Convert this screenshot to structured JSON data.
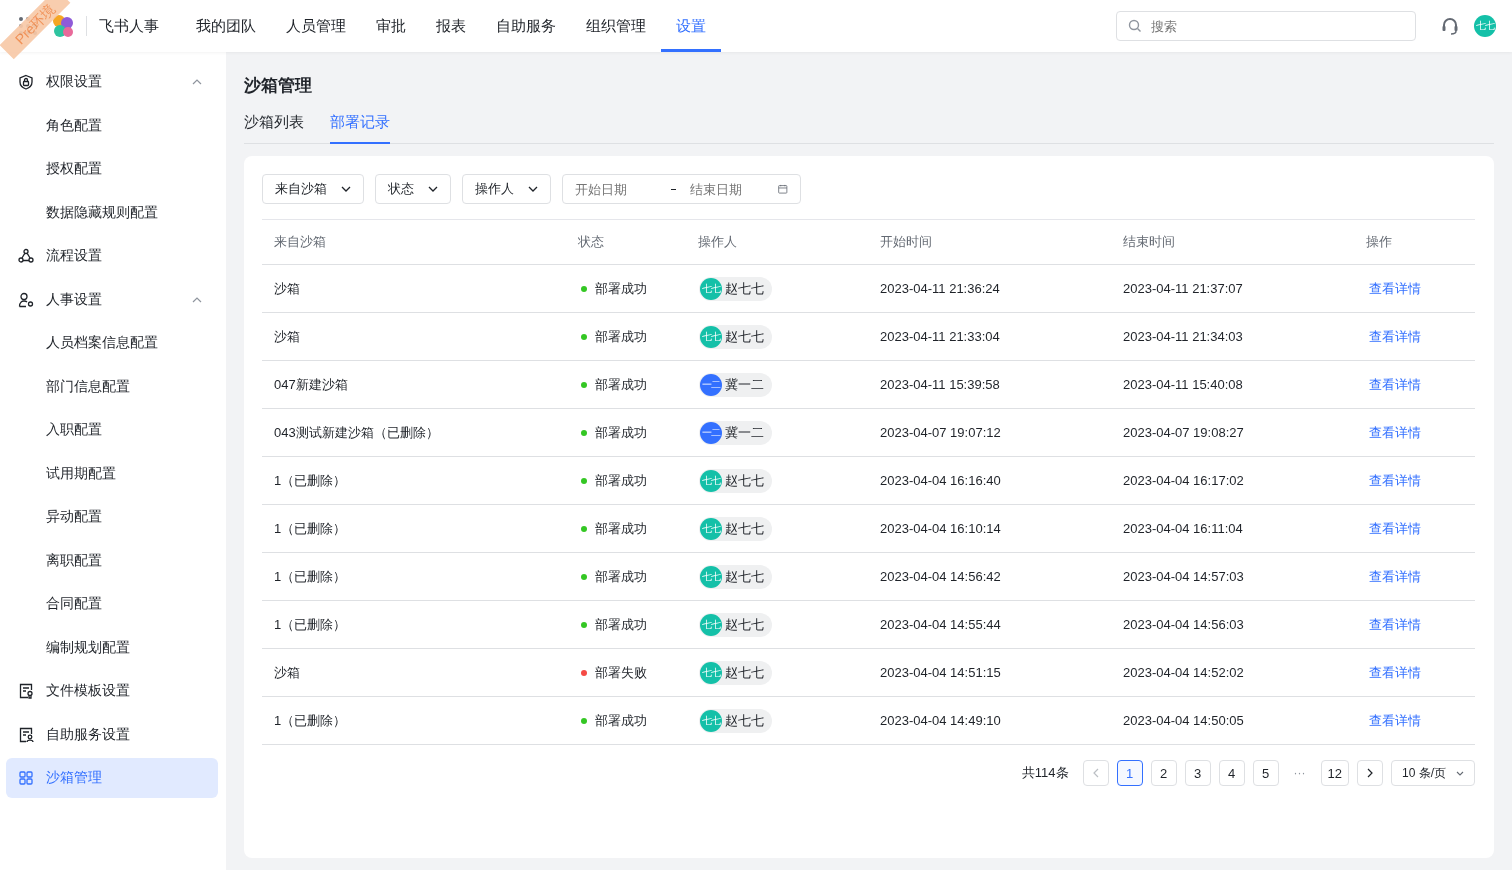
{
  "env_ribbon": "Pre环境",
  "header": {
    "app_name": "飞书人事",
    "nav": [
      {
        "label": "我的团队",
        "selected": false
      },
      {
        "label": "人员管理",
        "selected": false
      },
      {
        "label": "审批",
        "selected": false
      },
      {
        "label": "报表",
        "selected": false
      },
      {
        "label": "自助服务",
        "selected": false
      },
      {
        "label": "组织管理",
        "selected": false
      },
      {
        "label": "设置",
        "selected": true
      }
    ],
    "search": {
      "placeholder": "搜索"
    },
    "avatar": "七七"
  },
  "sidebar": {
    "items": [
      {
        "label": "权限设置",
        "expanded": true,
        "selected": false,
        "children": [
          {
            "label": "角色配置",
            "selected": false
          },
          {
            "label": "授权配置",
            "selected": false
          },
          {
            "label": "数据隐藏规则配置",
            "selected": false
          }
        ]
      },
      {
        "label": "流程设置",
        "selected": false
      },
      {
        "label": "人事设置",
        "expanded": true,
        "selected": false,
        "children": [
          {
            "label": "人员档案信息配置",
            "selected": false
          },
          {
            "label": "部门信息配置",
            "selected": false
          },
          {
            "label": "入职配置",
            "selected": false
          },
          {
            "label": "试用期配置",
            "selected": false
          },
          {
            "label": "异动配置",
            "selected": false
          },
          {
            "label": "离职配置",
            "selected": false
          },
          {
            "label": "合同配置",
            "selected": false
          },
          {
            "label": "编制规划配置",
            "selected": false
          }
        ]
      },
      {
        "label": "文件模板设置",
        "selected": false
      },
      {
        "label": "自助服务设置",
        "selected": false
      },
      {
        "label": "沙箱管理",
        "selected": true
      }
    ]
  },
  "page": {
    "title": "沙箱管理",
    "tabs": [
      {
        "label": "沙箱列表",
        "selected": false
      },
      {
        "label": "部署记录",
        "selected": true
      }
    ],
    "filters": {
      "selects": [
        "来自沙箱",
        "状态",
        "操作人"
      ],
      "date_range": {
        "start_placeholder": "开始日期",
        "end_placeholder": "结束日期"
      }
    },
    "table": {
      "columns": [
        "来自沙箱",
        "状态",
        "操作人",
        "开始时间",
        "结束时间",
        "操作"
      ],
      "rows": [
        {
          "source": "沙箱",
          "status": {
            "text": "部署成功",
            "color": "#34c724"
          },
          "operator": {
            "avatar": "七七",
            "name": "赵七七",
            "color": "#14c0a8"
          },
          "start": "2023-04-11 21:36:24",
          "end": "2023-04-11 21:37:07",
          "action": "查看详情"
        },
        {
          "source": "沙箱",
          "status": {
            "text": "部署成功",
            "color": "#34c724"
          },
          "operator": {
            "avatar": "七七",
            "name": "赵七七",
            "color": "#14c0a8"
          },
          "start": "2023-04-11 21:33:04",
          "end": "2023-04-11 21:34:03",
          "action": "查看详情"
        },
        {
          "source": "047新建沙箱",
          "status": {
            "text": "部署成功",
            "color": "#34c724"
          },
          "operator": {
            "avatar": "一二",
            "name": "冀一二",
            "color": "#3370ff"
          },
          "start": "2023-04-11 15:39:58",
          "end": "2023-04-11 15:40:08",
          "action": "查看详情"
        },
        {
          "source": "043测试新建沙箱（已删除）",
          "status": {
            "text": "部署成功",
            "color": "#34c724"
          },
          "operator": {
            "avatar": "一二",
            "name": "冀一二",
            "color": "#3370ff"
          },
          "start": "2023-04-07 19:07:12",
          "end": "2023-04-07 19:08:27",
          "action": "查看详情"
        },
        {
          "source": "1（已删除）",
          "status": {
            "text": "部署成功",
            "color": "#34c724"
          },
          "operator": {
            "avatar": "七七",
            "name": "赵七七",
            "color": "#14c0a8"
          },
          "start": "2023-04-04 16:16:40",
          "end": "2023-04-04 16:17:02",
          "action": "查看详情"
        },
        {
          "source": "1（已删除）",
          "status": {
            "text": "部署成功",
            "color": "#34c724"
          },
          "operator": {
            "avatar": "七七",
            "name": "赵七七",
            "color": "#14c0a8"
          },
          "start": "2023-04-04 16:10:14",
          "end": "2023-04-04 16:11:04",
          "action": "查看详情"
        },
        {
          "source": "1（已删除）",
          "status": {
            "text": "部署成功",
            "color": "#34c724"
          },
          "operator": {
            "avatar": "七七",
            "name": "赵七七",
            "color": "#14c0a8"
          },
          "start": "2023-04-04 14:56:42",
          "end": "2023-04-04 14:57:03",
          "action": "查看详情"
        },
        {
          "source": "1（已删除）",
          "status": {
            "text": "部署成功",
            "color": "#34c724"
          },
          "operator": {
            "avatar": "七七",
            "name": "赵七七",
            "color": "#14c0a8"
          },
          "start": "2023-04-04 14:55:44",
          "end": "2023-04-04 14:56:03",
          "action": "查看详情"
        },
        {
          "source": "沙箱",
          "status": {
            "text": "部署失败",
            "color": "#f54a45"
          },
          "operator": {
            "avatar": "七七",
            "name": "赵七七",
            "color": "#14c0a8"
          },
          "start": "2023-04-04 14:51:15",
          "end": "2023-04-04 14:52:02",
          "action": "查看详情"
        },
        {
          "source": "1（已删除）",
          "status": {
            "text": "部署成功",
            "color": "#34c724"
          },
          "operator": {
            "avatar": "七七",
            "name": "赵七七",
            "color": "#14c0a8"
          },
          "start": "2023-04-04 14:49:10",
          "end": "2023-04-04 14:50:05",
          "action": "查看详情"
        }
      ]
    },
    "pagination": {
      "total": "共114条",
      "pages": [
        {
          "label": "1",
          "selected": true
        },
        {
          "label": "2",
          "selected": false
        },
        {
          "label": "3",
          "selected": false
        },
        {
          "label": "4",
          "selected": false
        },
        {
          "label": "5",
          "selected": false
        },
        {
          "label": "···",
          "kind": "ellipsis"
        },
        {
          "label": "12",
          "selected": false
        }
      ],
      "page_size": "10 条/页"
    }
  }
}
